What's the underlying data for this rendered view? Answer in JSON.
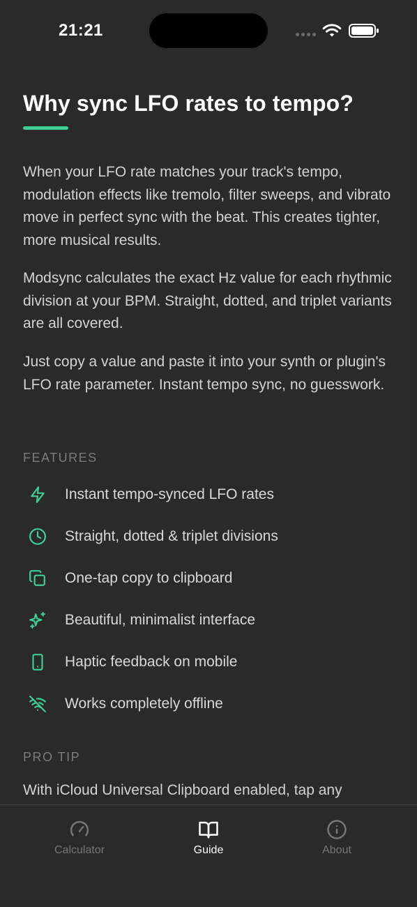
{
  "status_bar": {
    "time": "21:21"
  },
  "guide": {
    "title": "Why sync LFO rates to tempo?",
    "paragraphs": [
      "When your LFO rate matches your track's tempo, modulation effects like tremolo, filter sweeps, and vibrato move in perfect sync with the beat. This creates tighter, more musical results.",
      "Modsync calculates the exact Hz value for each rhythmic division at your BPM. Straight, dotted, and triplet variants are all covered.",
      "Just copy a value and paste it into your synth or plugin's LFO rate parameter. Instant tempo sync, no guesswork."
    ],
    "features_header": "FEATURES",
    "features": [
      {
        "icon": "lightning-icon",
        "label": "Instant tempo-synced LFO rates"
      },
      {
        "icon": "clock-icon",
        "label": "Straight, dotted & triplet divisions"
      },
      {
        "icon": "copy-icon",
        "label": "One-tap copy to clipboard"
      },
      {
        "icon": "sparkles-icon",
        "label": "Beautiful, minimalist interface"
      },
      {
        "icon": "phone-icon",
        "label": "Haptic feedback on mobile"
      },
      {
        "icon": "wifi-off-icon",
        "label": "Works completely offline"
      }
    ],
    "protip_header": "PRO TIP",
    "protip_text": "With iCloud Universal Clipboard enabled, tap any"
  },
  "tabs": [
    {
      "icon": "gauge-icon",
      "label": "Calculator",
      "active": false
    },
    {
      "icon": "book-icon",
      "label": "Guide",
      "active": true
    },
    {
      "icon": "info-icon",
      "label": "About",
      "active": false
    }
  ],
  "colors": {
    "accent": "#3ecf98",
    "background": "#2a2a2a"
  }
}
